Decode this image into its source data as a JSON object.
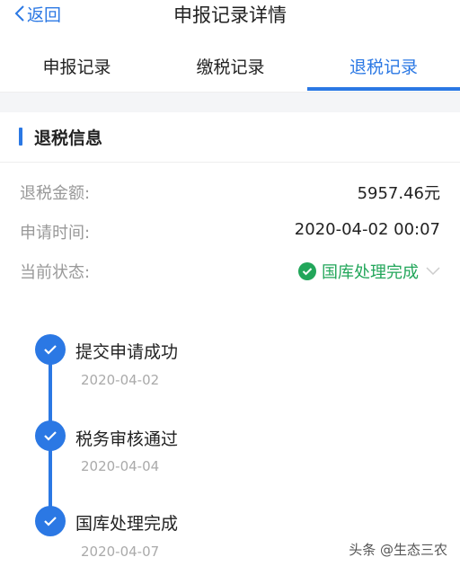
{
  "navbar": {
    "back_label": "返回",
    "title": "申报记录详情"
  },
  "tabs": [
    {
      "label": "申报记录",
      "active": false
    },
    {
      "label": "缴税记录",
      "active": false
    },
    {
      "label": "退税记录",
      "active": true
    }
  ],
  "section": {
    "title": "退税信息"
  },
  "info": {
    "amount_label": "退税金额:",
    "amount_value": "5957.46元",
    "time_label": "申请时间:",
    "time_value": "2020-04-02 00:07",
    "status_label": "当前状态:",
    "status_value": "国库处理完成"
  },
  "timeline": [
    {
      "title": "提交申请成功",
      "date": "2020-04-02"
    },
    {
      "title": "税务审核通过",
      "date": "2020-04-04"
    },
    {
      "title": "国库处理完成",
      "date": "2020-04-07"
    }
  ],
  "watermark": "头条 @生态三农",
  "colors": {
    "accent": "#2b78e4",
    "success": "#22a65a",
    "muted": "#999999"
  },
  "icons": [
    "back-chevron-icon",
    "check-circle-icon",
    "chevron-down-icon",
    "check-icon"
  ]
}
